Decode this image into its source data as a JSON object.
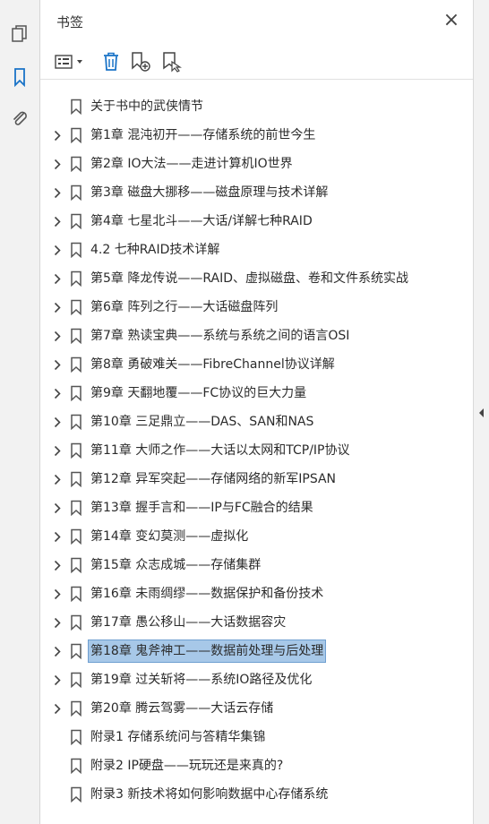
{
  "panel": {
    "title": "书签",
    "close_symbol": "×"
  },
  "rail": [
    "pages-icon",
    "bookmark-icon",
    "attachment-icon"
  ],
  "toolbar": [
    "options-menu-icon",
    "delete-bookmark-icon",
    "new-bookmark-icon",
    "bookmark-from-selection-icon"
  ],
  "bookmarks": [
    {
      "label": "关于书中的武侠情节",
      "expandable": false
    },
    {
      "label": "第1章 混沌初开——存储系统的前世今生",
      "expandable": true
    },
    {
      "label": "第2章 IO大法——走进计算机IO世界",
      "expandable": true
    },
    {
      "label": "第3章 磁盘大挪移——磁盘原理与技术详解",
      "expandable": true
    },
    {
      "label": "第4章 七星北斗——大话/详解七种RAID",
      "expandable": true
    },
    {
      "label": "4.2 七种RAID技术详解",
      "expandable": true
    },
    {
      "label": "第5章 降龙传说——RAID、虚拟磁盘、卷和文件系统实战",
      "expandable": true
    },
    {
      "label": "第6章 阵列之行——大话磁盘阵列",
      "expandable": true
    },
    {
      "label": "第7章 熟读宝典——系统与系统之间的语言OSI",
      "expandable": true
    },
    {
      "label": "第8章 勇破难关——FibreChannel协议详解",
      "expandable": true
    },
    {
      "label": "第9章 天翻地覆——FC协议的巨大力量",
      "expandable": true
    },
    {
      "label": "第10章 三足鼎立——DAS、SAN和NAS",
      "expandable": true
    },
    {
      "label": "第11章 大师之作——大话以太网和TCP/IP协议",
      "expandable": true
    },
    {
      "label": "第12章 异军突起——存储网络的新军IPSAN",
      "expandable": true
    },
    {
      "label": "第13章 握手言和——IP与FC融合的结果",
      "expandable": true
    },
    {
      "label": "第14章 变幻莫测——虚拟化",
      "expandable": true
    },
    {
      "label": "第15章 众志成城——存储集群",
      "expandable": true
    },
    {
      "label": "第16章 未雨绸缪——数据保护和备份技术",
      "expandable": true
    },
    {
      "label": "第17章 愚公移山——大话数据容灾",
      "expandable": true
    },
    {
      "label": "第18章 鬼斧神工——数据前处理与后处理",
      "expandable": true,
      "selected": true
    },
    {
      "label": "第19章 过关斩将——系统IO路径及优化",
      "expandable": true
    },
    {
      "label": "第20章 腾云驾雾——大话云存储",
      "expandable": true
    },
    {
      "label": "附录1 存储系统问与答精华集锦",
      "expandable": false
    },
    {
      "label": "附录2 IP硬盘——玩玩还是来真的?",
      "expandable": false
    },
    {
      "label": "附录3 新技术将如何影响数据中心存储系统",
      "expandable": false
    }
  ]
}
